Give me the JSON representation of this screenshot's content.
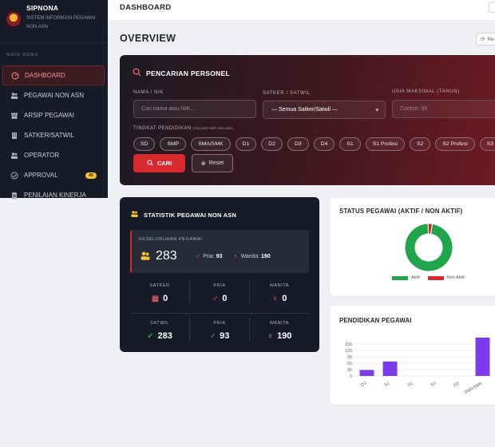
{
  "brand": {
    "title": "SIPNONA",
    "subtitle": "SISTEM INFORMASI PEGAWAI NON ASN"
  },
  "sidebar": {
    "section_label": "MAIN MENU",
    "items": [
      {
        "label": "DASHBOARD",
        "icon": "dashboard-icon",
        "active": true
      },
      {
        "label": "PEGAWAI NON ASN",
        "icon": "users-icon"
      },
      {
        "label": "ARSIP PEGAWAI",
        "icon": "archive-icon"
      },
      {
        "label": "SATKER/SATWIL",
        "icon": "building-icon"
      },
      {
        "label": "OPERATOR",
        "icon": "users-icon"
      },
      {
        "label": "APPROVAL",
        "icon": "check-circle-icon",
        "badge": "45"
      },
      {
        "label": "PENILAIAN KINERJA",
        "icon": "clipboard-icon"
      }
    ]
  },
  "topbar": {
    "title": "DASHBOARD"
  },
  "overview": {
    "title": "OVERVIEW",
    "refresh_label": "Re"
  },
  "search": {
    "title": "PENCARIAN PERSONEL",
    "name_label": "NAMA / NIK",
    "name_placeholder": "Cari nama atau NIK...",
    "satker_label": "SATKER / SATWIL",
    "satker_value": "— Semua Satker/Satwil —",
    "age_label": "USIA MAKSIMAL (TAHUN)",
    "age_placeholder": "Contoh: 35",
    "level_label": "TINGKAT PENDIDIKAN",
    "level_hint": "(bisa pilih lebih dari satu)",
    "levels": [
      "SD",
      "SMP",
      "SMA/SMK",
      "D1",
      "D2",
      "D3",
      "D4",
      "S1",
      "S1 Profesi",
      "S2",
      "S2 Profesi",
      "S3"
    ],
    "search_button": "CARI",
    "reset_button": "Reset"
  },
  "stats": {
    "title": "STATISTIK PEGAWAI NON ASN",
    "total_label": "KESELURUHAN PEGAWAI",
    "total": "283",
    "pria_label": "Pria:",
    "pria": "93",
    "wanita_label": "Wanita:",
    "wanita": "190",
    "satker": {
      "label": "SATKER",
      "value": "0",
      "pria_label": "PRIA",
      "pria": "0",
      "wanita_label": "WANITA",
      "wanita": "0"
    },
    "satwil": {
      "label": "SATWIL",
      "value": "283",
      "pria_label": "PRIA",
      "pria": "93",
      "wanita_label": "WANITA",
      "wanita": "190"
    }
  },
  "status_chart": {
    "title": "STATUS PEGAWAI (AKTIF / NON AKTIF)",
    "legend": [
      "Aktif",
      "Non Aktif"
    ],
    "colors": {
      "aktif": "#1fa64a",
      "non_aktif": "#d72a2e"
    }
  },
  "edu_chart": {
    "title": "PENDIDIKAN PEGAWAI",
    "bar_color": "#7c3aed"
  },
  "chart_data": [
    {
      "type": "pie",
      "title": "STATUS PEGAWAI (AKTIF / NON AKTIF)",
      "categories": [
        "Aktif",
        "Non Aktif"
      ],
      "values": [
        275,
        8
      ],
      "donut": true,
      "legend": "bottom"
    },
    {
      "type": "bar",
      "title": "PENDIDIKAN PEGAWAI",
      "categories": [
        "D3",
        "S1",
        "S2",
        "S3",
        "SD",
        "SMA/SMK"
      ],
      "values": [
        28,
        68,
        0,
        0,
        0,
        180
      ],
      "yticks": [
        0,
        30,
        60,
        90,
        120,
        150
      ],
      "ylim": [
        0,
        180
      ],
      "grid": true
    }
  ]
}
